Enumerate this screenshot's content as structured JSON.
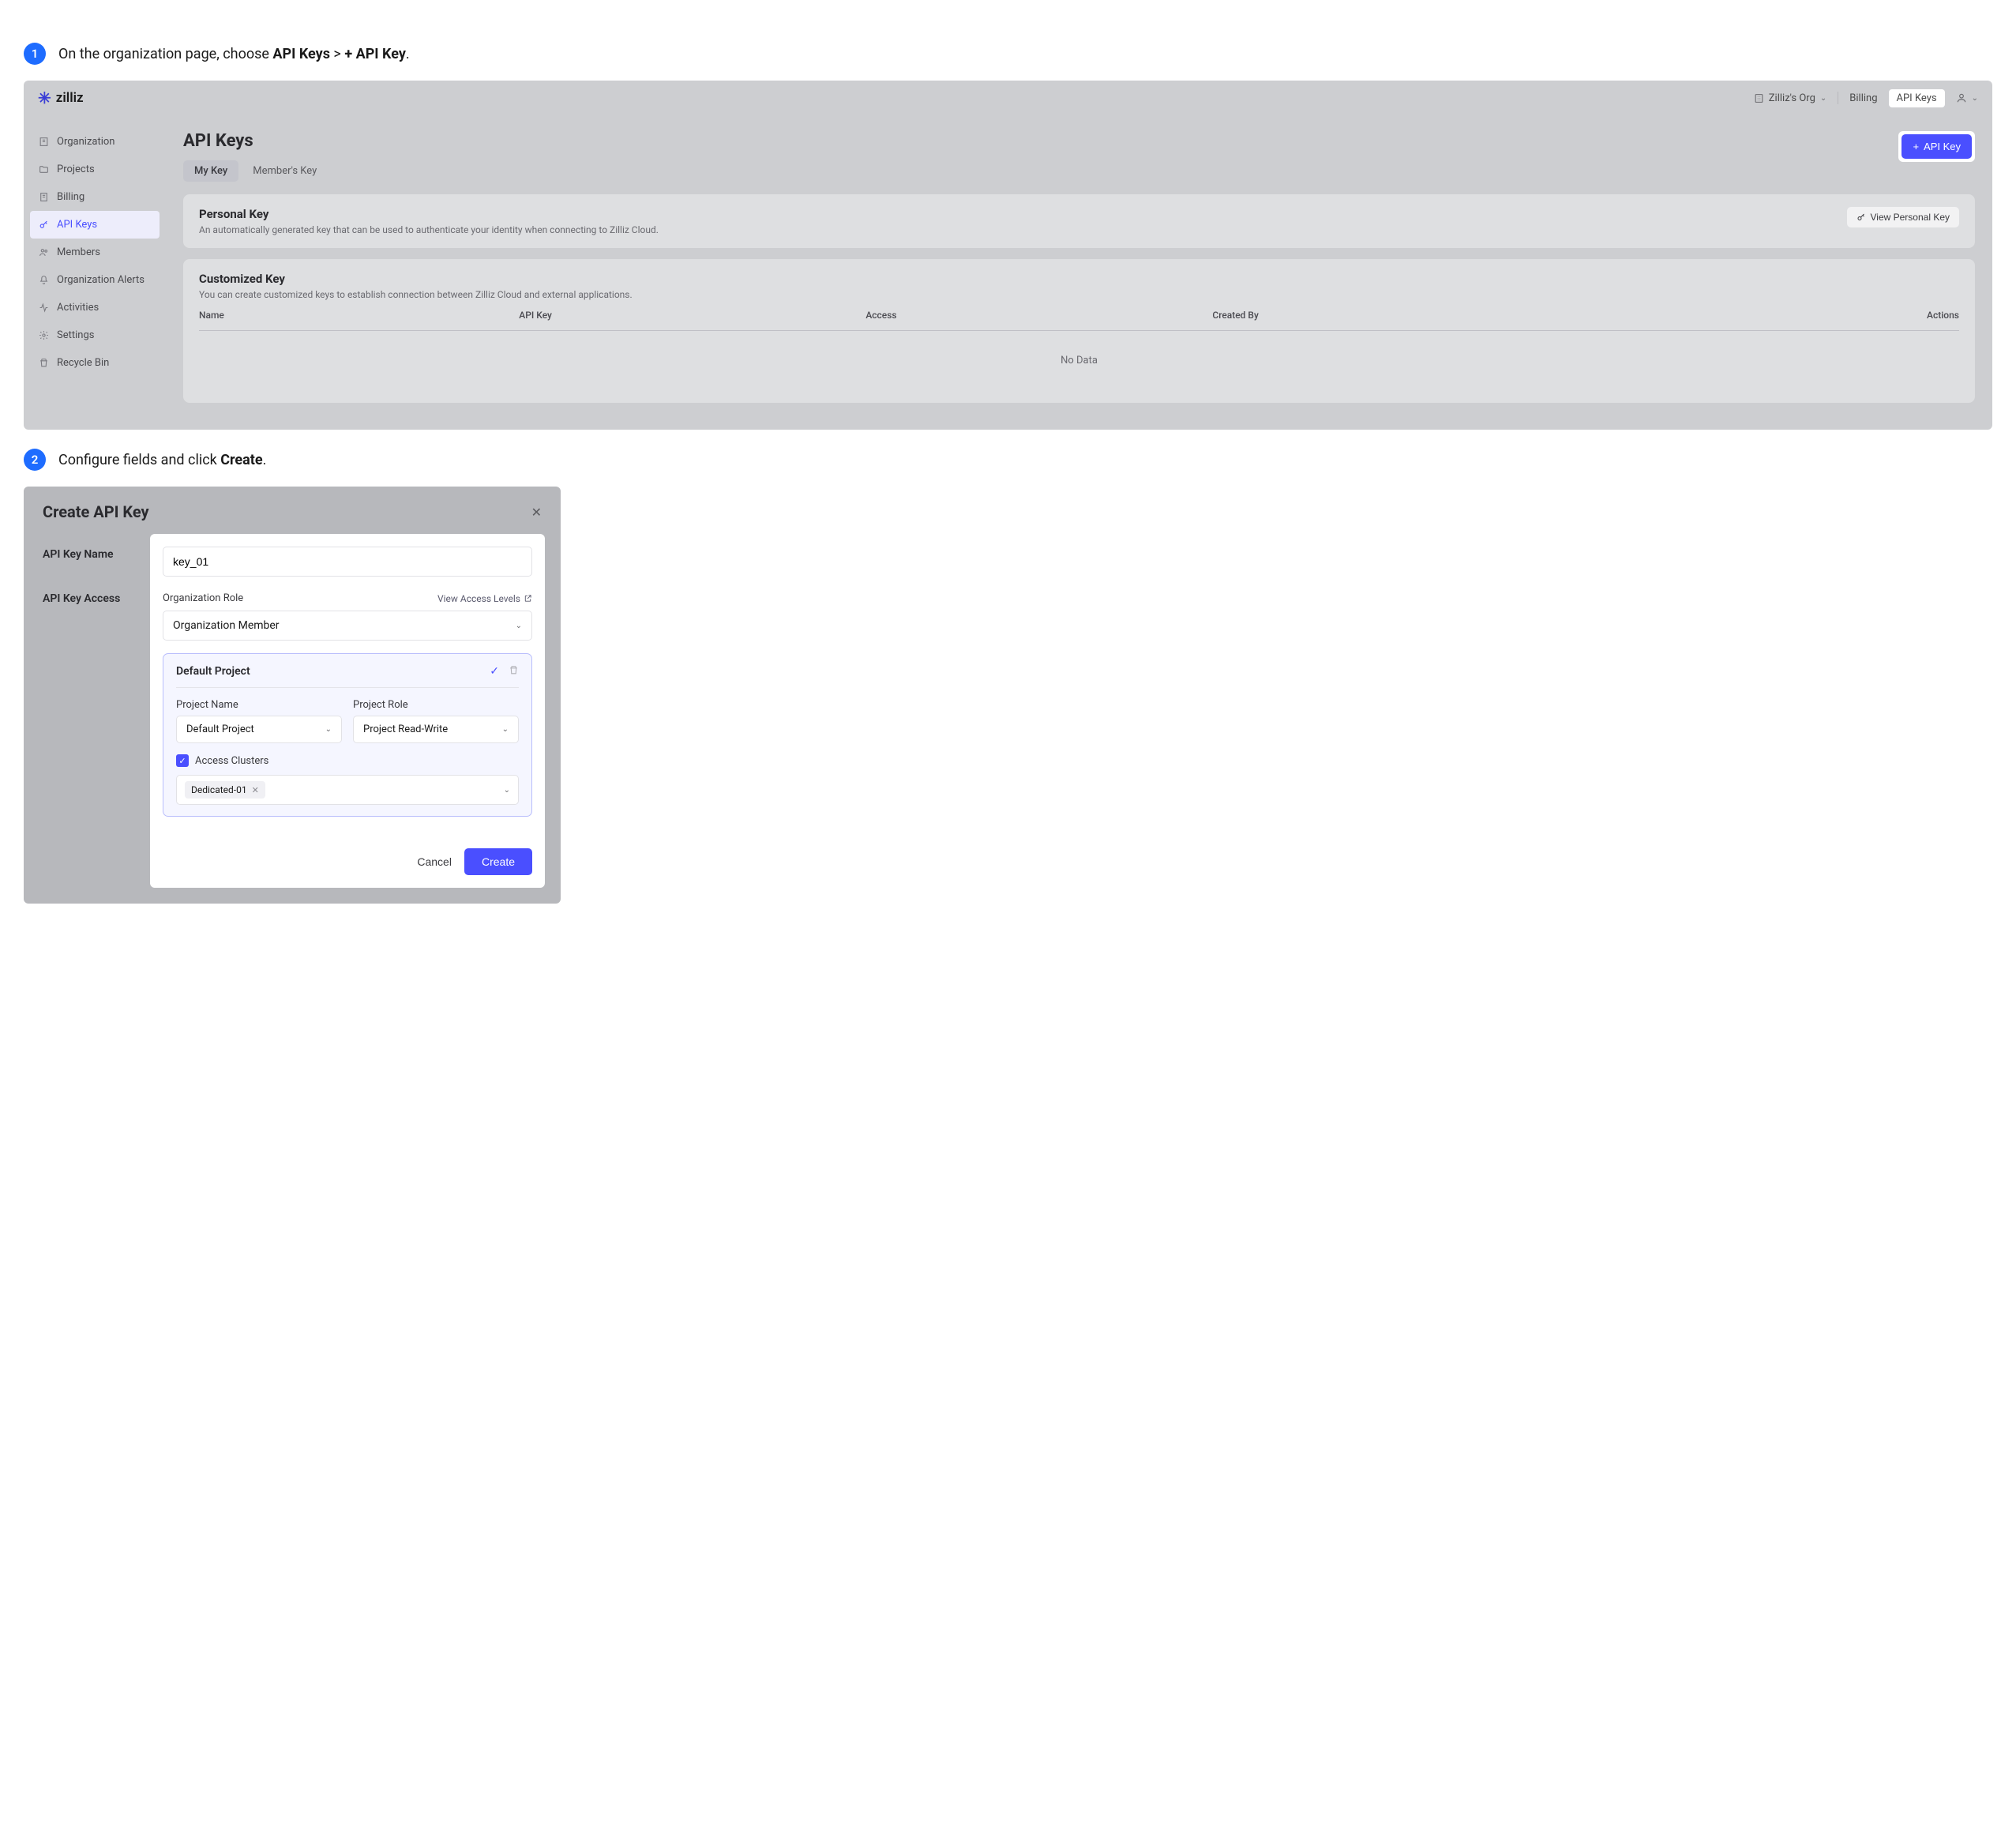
{
  "step1": {
    "num": "1",
    "text_prefix": "On the organization page, choose ",
    "text_bold1": "API Keys",
    "text_mid": " > ",
    "text_bold2": "+ API Key",
    "text_suffix": "."
  },
  "step2": {
    "num": "2",
    "text_prefix": "Configure fields and click ",
    "text_bold": "Create",
    "text_suffix": "."
  },
  "topbar": {
    "logo": "zilliz",
    "org_name": "Zilliz's Org",
    "billing": "Billing",
    "apikeys": "API Keys"
  },
  "sidebar": {
    "items": [
      {
        "label": "Organization"
      },
      {
        "label": "Projects"
      },
      {
        "label": "Billing"
      },
      {
        "label": "API Keys"
      },
      {
        "label": "Members"
      },
      {
        "label": "Organization Alerts"
      },
      {
        "label": "Activities"
      },
      {
        "label": "Settings"
      },
      {
        "label": "Recycle Bin"
      }
    ]
  },
  "main": {
    "title": "API Keys",
    "add_btn": "API Key",
    "tabs": {
      "my": "My Key",
      "member": "Member's Key"
    },
    "personal": {
      "title": "Personal Key",
      "desc": "An automatically generated key that can be used to authenticate your identity when connecting to Zilliz Cloud.",
      "view_btn": "View Personal Key"
    },
    "custom": {
      "title": "Customized Key",
      "desc": "You can create customized keys to establish connection between Zilliz Cloud and external applications.",
      "cols": {
        "name": "Name",
        "apikey": "API Key",
        "access": "Access",
        "created_by": "Created By",
        "actions": "Actions"
      },
      "no_data": "No Data"
    }
  },
  "modal": {
    "title": "Create API Key",
    "labels": {
      "name": "API Key Name",
      "access": "API Key Access"
    },
    "key_name_value": "key_01",
    "org_role_label": "Organization Role",
    "view_levels": "View Access Levels",
    "org_role_value": "Organization Member",
    "project_box": {
      "title": "Default Project",
      "project_name_label": "Project Name",
      "project_name_value": "Default Project",
      "project_role_label": "Project Role",
      "project_role_value": "Project Read-Write",
      "access_clusters_label": "Access Clusters",
      "cluster_chip": "Dedicated-01"
    },
    "cancel": "Cancel",
    "create": "Create"
  }
}
